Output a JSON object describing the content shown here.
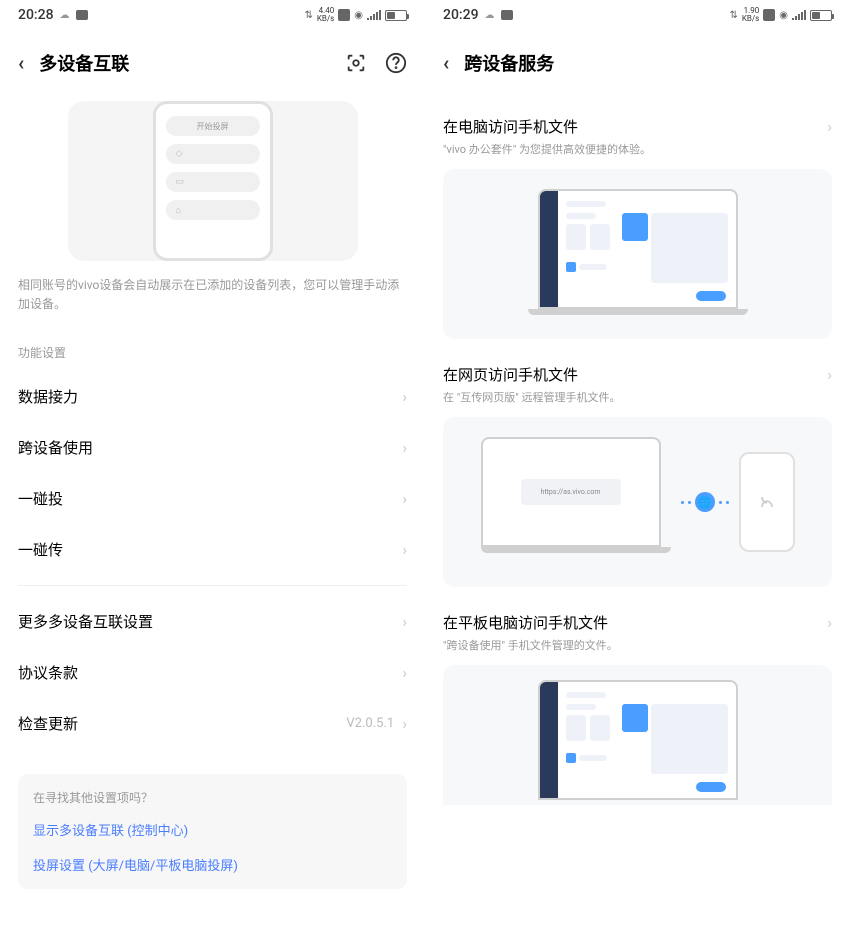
{
  "left": {
    "status": {
      "time": "20:28",
      "net_rate": "4.40",
      "net_unit": "KB/s",
      "battery": "47"
    },
    "title": "多设备互联",
    "phone_label": "开始投屏",
    "description": "相同账号的vivo设备会自动展示在已添加的设备列表，您可以管理手动添加设备。",
    "section_label": "功能设置",
    "rows": {
      "data_relay": "数据接力",
      "cross_device": "跨设备使用",
      "one_touch_cast": "一碰投",
      "one_touch_transfer": "一碰传",
      "more_settings": "更多多设备互联设置",
      "terms": "协议条款",
      "check_update": "检查更新",
      "version": "V2.0.5.1"
    },
    "hint": {
      "title": "在寻找其他设置项吗？",
      "link1": "显示多设备互联 (控制中心)",
      "link2": "投屏设置 (大屏/电脑/平板电脑投屏)"
    }
  },
  "right": {
    "status": {
      "time": "20:29",
      "net_rate": "1.90",
      "net_unit": "KB/s",
      "battery": "47"
    },
    "title": "跨设备服务",
    "cards": {
      "pc": {
        "title": "在电脑访问手机文件",
        "sub": "\"vivo 办公套件\" 为您提供高效便捷的体验。",
        "url": ""
      },
      "web": {
        "title": "在网页访问手机文件",
        "sub": "在 \"互传网页版\" 远程管理手机文件。",
        "url": "https://as.vivo.com"
      },
      "tablet": {
        "title": "在平板电脑访问手机文件",
        "sub": "\"跨设备使用\" 手机文件管理的文件。"
      }
    }
  }
}
